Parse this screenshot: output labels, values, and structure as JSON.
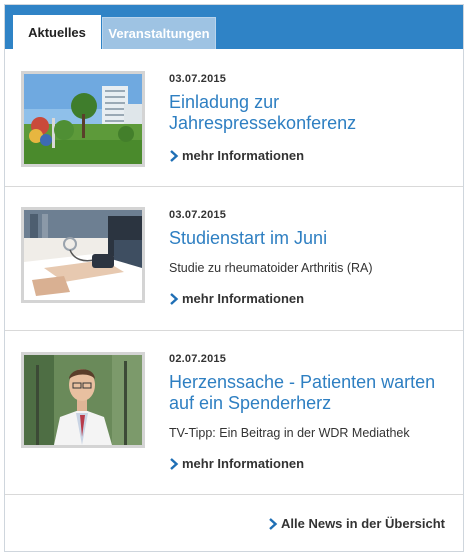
{
  "tabs": [
    {
      "label": "Aktuelles",
      "active": true
    },
    {
      "label": "Veranstaltungen",
      "active": false
    }
  ],
  "news": [
    {
      "date": "03.07.2015",
      "title": "Einladung zur Jahrespressekonferenz",
      "teaser": "",
      "more_label": "mehr Informationen",
      "image": "hospital-building-photo"
    },
    {
      "date": "03.07.2015",
      "title": "Studienstart im Juni",
      "teaser": "Studie zu rheumatoider Arthritis (RA)",
      "more_label": "mehr Informationen",
      "image": "blood-pressure-measurement-photo"
    },
    {
      "date": "02.07.2015",
      "title": "Herzenssache - Patienten warten auf ein Spenderherz",
      "teaser": "TV-Tipp: Ein Beitrag in der WDR Mediathek",
      "more_label": "mehr Informationen",
      "image": "doctor-portrait-photo"
    }
  ],
  "footer": {
    "all_news_label": "Alle News in der Übersicht"
  },
  "colors": {
    "header_blue": "#2f83c6",
    "inactive_tab": "#9ec3e3",
    "link_blue": "#2e7fc2",
    "chevron_blue": "#1f6fb5"
  }
}
